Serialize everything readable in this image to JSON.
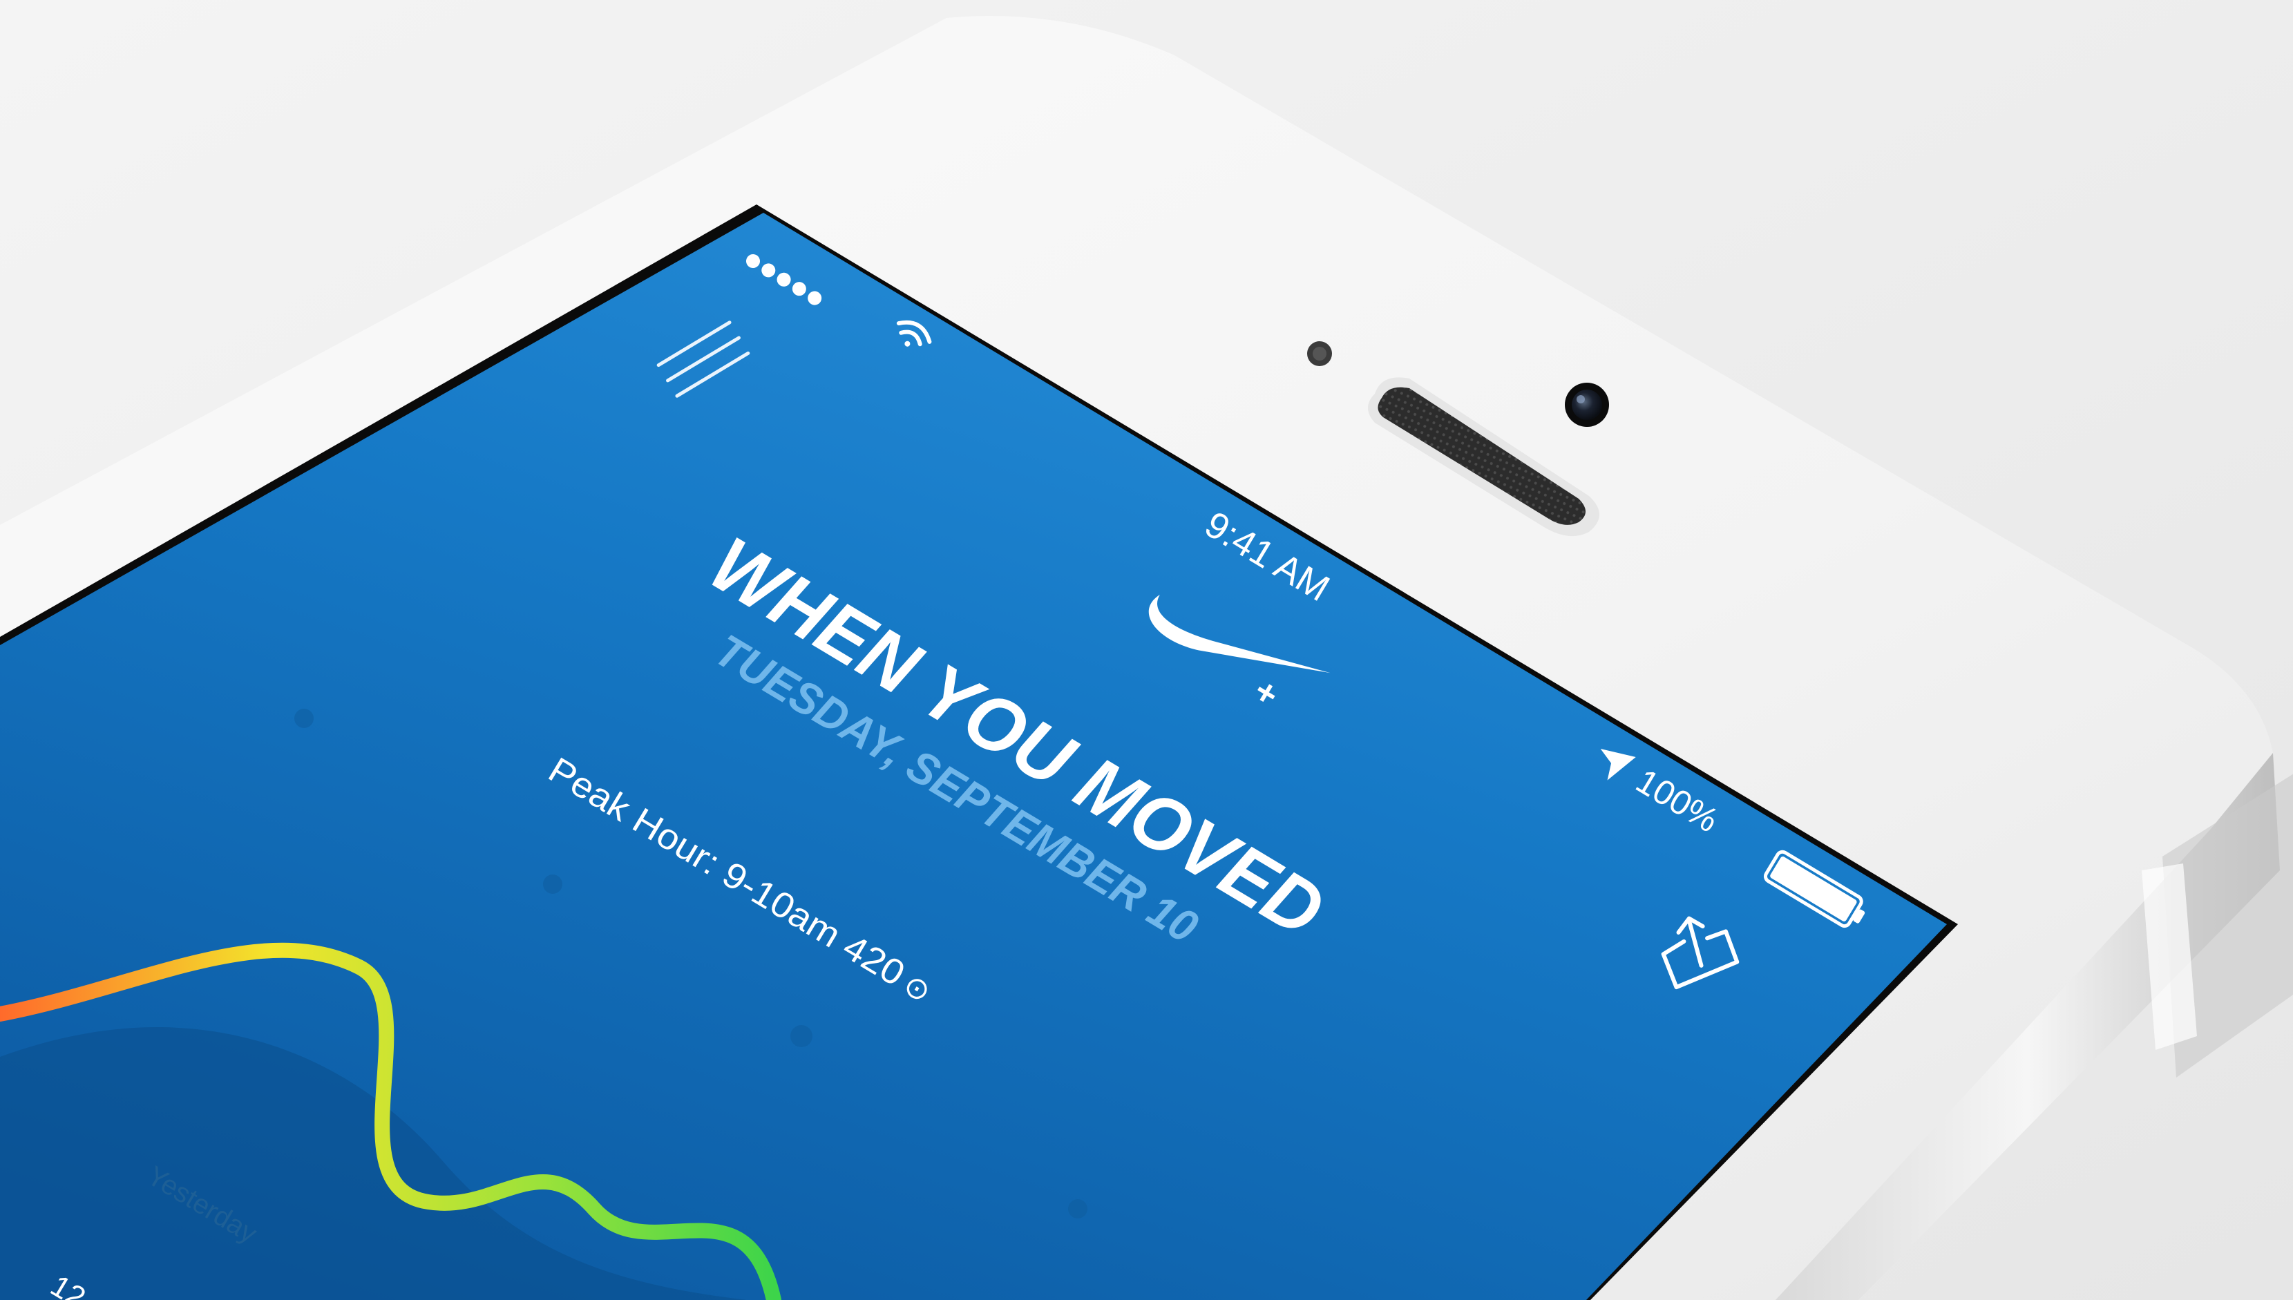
{
  "status_bar": {
    "signal_dots": 5,
    "time": "9:41 AM",
    "battery_percent": "100%",
    "battery_level": 1.0
  },
  "app": {
    "brand": "Nike+",
    "heading": "WHEN YOU MOVED",
    "date": "TUESDAY, SEPTEMBER 10",
    "peak_hour": "Peak Hour: 9-10am 420",
    "fuel_symbol": "⊙",
    "chart_label_yesterday": "Yesterday",
    "chart_axis_start": "12"
  },
  "colors": {
    "screen_top": "#1a7fcc",
    "screen_bottom": "#0d5fa8",
    "phone_body": "#f7f7f7",
    "wave_start": "#ff6a2b",
    "wave_mid": "#f5ea2c",
    "wave_end": "#3dd44a"
  },
  "icons": [
    "menu-icon",
    "wifi-icon",
    "nike-swoosh-icon",
    "location-arrow-icon",
    "battery-icon",
    "share-icon"
  ]
}
